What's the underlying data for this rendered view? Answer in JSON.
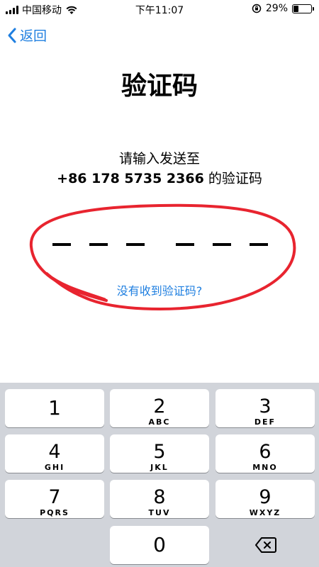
{
  "status_bar": {
    "carrier": "中国移动",
    "time": "下午11:07",
    "battery_percent": "29%",
    "battery_level": 0.29
  },
  "nav": {
    "back_label": "返回"
  },
  "page": {
    "title": "验证码",
    "instruction_line1": "请输入发送至",
    "phone_number": "+86 178 5735 2366",
    "instruction_suffix": " 的验证码",
    "resend_link": "没有收到验证码?"
  },
  "code": {
    "slots": 6,
    "filled": ""
  },
  "colors": {
    "accent": "#1f7fe0",
    "annotation": "#e8242f",
    "keypad_bg": "#d1d4da"
  },
  "keypad": {
    "keys": [
      {
        "digit": "1",
        "letters": ""
      },
      {
        "digit": "2",
        "letters": "ABC"
      },
      {
        "digit": "3",
        "letters": "DEF"
      },
      {
        "digit": "4",
        "letters": "GHI"
      },
      {
        "digit": "5",
        "letters": "JKL"
      },
      {
        "digit": "6",
        "letters": "MNO"
      },
      {
        "digit": "7",
        "letters": "PQRS"
      },
      {
        "digit": "8",
        "letters": "TUV"
      },
      {
        "digit": "9",
        "letters": "WXYZ"
      },
      {
        "digit": "0",
        "letters": ""
      }
    ],
    "delete_icon": "backspace-icon"
  }
}
